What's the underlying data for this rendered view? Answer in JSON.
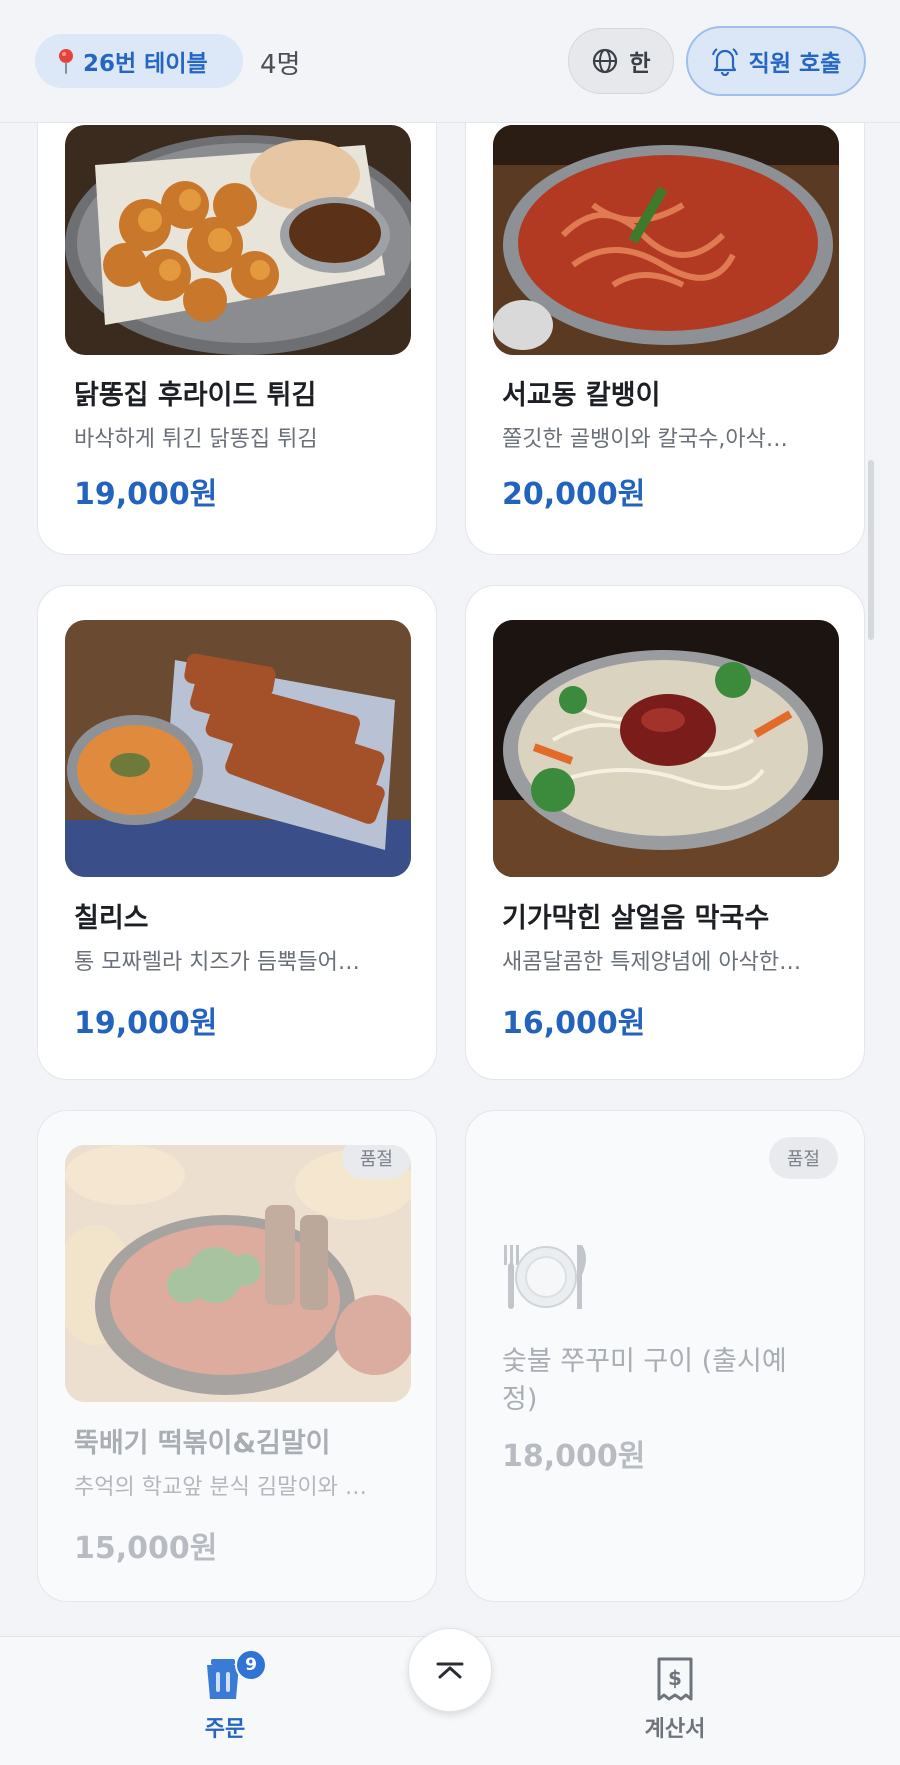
{
  "header": {
    "table_label": "26번 테이블",
    "guest_count": "4명",
    "language_label": "한",
    "staff_call_label": "직원 호출"
  },
  "menu": [
    {
      "name": "닭똥집 후라이드 튀김",
      "desc": "바삭하게 튀긴 닭똥집 튀김",
      "price": "19,000원"
    },
    {
      "name": "서교동 칼뱅이",
      "desc": "쫄깃한 골뱅이와 칼국수,아삭…",
      "price": "20,000원"
    },
    {
      "name": "칠리스",
      "desc": "통 모짜렐라 치즈가 듬뿍들어…",
      "price": "19,000원"
    },
    {
      "name": "기가막힌 살얼음 막국수",
      "desc": "새콤달콤한 특제양념에 아삭한…",
      "price": "16,000원"
    },
    {
      "name": "뚝배기 떡볶이&김말이",
      "desc": "추억의 학교앞 분식 김말이와 …",
      "price": "15,000원",
      "badge": "품절"
    },
    {
      "name": "숯불 쭈꾸미 구이 (출시예정)",
      "name_line1": "숯불 쭈꾸미 구이 (출시예",
      "name_line2": "정)",
      "price": "18,000원",
      "badge": "품절",
      "placeholder_icon": "plate-cutlery-icon"
    }
  ],
  "bottom_nav": {
    "order_label": "주문",
    "order_badge": "9",
    "bill_label": "계산서"
  },
  "icons": {
    "pin": "pin-icon",
    "globe": "globe-icon",
    "bell": "bell-icon",
    "cart": "cart-icon",
    "bill": "receipt-icon",
    "scroll_top": "chevron-up-icon"
  },
  "colors": {
    "accent": "#2566c2",
    "price": "#2362bd",
    "background": "#f2f4f7"
  }
}
